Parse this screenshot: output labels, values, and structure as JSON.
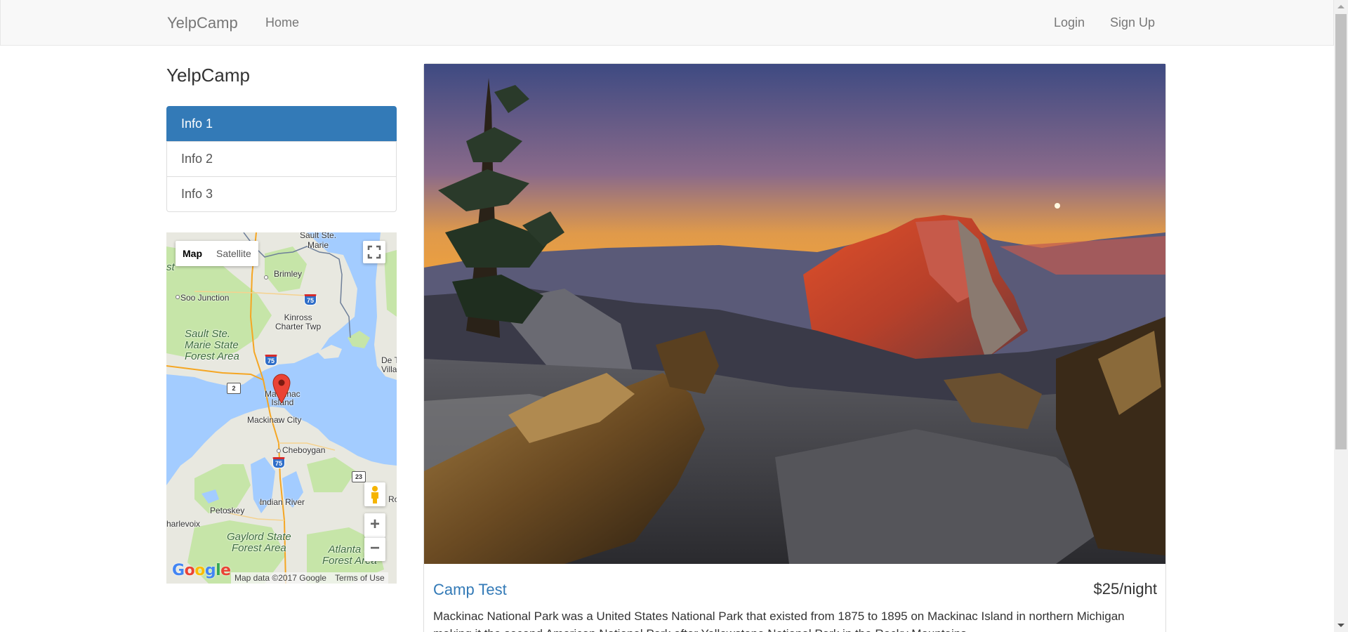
{
  "navbar": {
    "brand": "YelpCamp",
    "home": "Home",
    "login": "Login",
    "signup": "Sign Up",
    "background": "#f8f8f8"
  },
  "sidebar": {
    "lead": "YelpCamp",
    "items": [
      {
        "label": "Info 1",
        "active": true
      },
      {
        "label": "Info 2",
        "active": false
      },
      {
        "label": "Info 3",
        "active": false
      }
    ],
    "active_color": "#337ab7"
  },
  "map": {
    "type_buttons": [
      "Map",
      "Satellite"
    ],
    "selected_type": "Map",
    "zoom_in": "+",
    "zoom_out": "−",
    "logo": "Google",
    "data_text": "Map data ©2017 Google",
    "terms": "Terms of Use",
    "labels": {
      "sault_ste_marie": "Sault Ste.\nMarie",
      "brimley": "Brimley",
      "soo_junction": "Soo Junction",
      "kinross": "Kinross\nCharter Twp",
      "forest": "Sault Ste.\nMarie State\nForest Area",
      "de_tour": "De To\nVilla",
      "mackinac_island": "Mackinac\nIsland",
      "mackinaw_city": "Mackinaw City",
      "cheboygan": "Cheboygan",
      "indian_river": "Indian River",
      "petoskey": "Petoskey",
      "harlevoix": "harlevoix",
      "gaylord": "Gaylord State\nForest Area",
      "atlanta": "Atlanta S\nForest Area",
      "ro": "Ro",
      "st": "st"
    },
    "shields": {
      "i75_a": "75",
      "i75_b": "75",
      "i75_c": "75",
      "us2": "2",
      "m23": "23"
    },
    "water_color": "#a3ccff",
    "land_color": "#e8e8e0",
    "park_color": "#c6e5a8"
  },
  "campground": {
    "name": "Camp Test",
    "price": "$25/night",
    "description": "Mackinac National Park was a United States National Park that existed from 1875 to 1895 on Mackinac Island in northern Michigan making it the second American National Park after Yellowstone National Park in the Rocky Mountains.",
    "link_color": "#337ab7"
  }
}
